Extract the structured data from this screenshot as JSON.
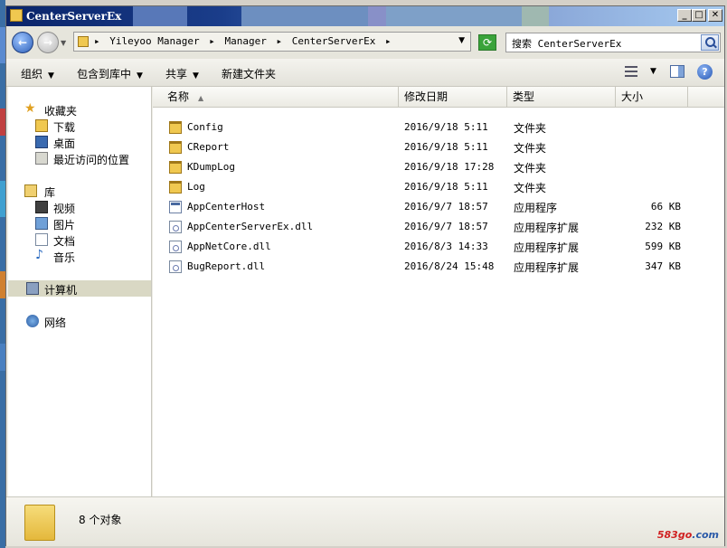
{
  "window": {
    "title": "CenterServerEx",
    "controls": {
      "minimize": "_",
      "maximize": "□",
      "close": "✕"
    }
  },
  "address_bar": {
    "crumbs": [
      "Yileyoo Manager",
      "Manager",
      "CenterServerEx"
    ],
    "separator": "▸",
    "search_placeholder": "搜索 CenterServerEx"
  },
  "toolbar": {
    "organize": "组织",
    "include_in_library": "包含到库中",
    "share": "共享",
    "new_folder": "新建文件夹"
  },
  "nav": {
    "favorites": "收藏夹",
    "downloads": "下载",
    "desktop": "桌面",
    "recent": "最近访问的位置",
    "libraries": "库",
    "videos": "视频",
    "pictures": "图片",
    "documents": "文档",
    "music": "音乐",
    "computer": "计算机",
    "network": "网络"
  },
  "columns": {
    "name": "名称",
    "date": "修改日期",
    "type": "类型",
    "size": "大小"
  },
  "files": [
    {
      "name": "Config",
      "date": "2016/9/18 5:11",
      "type": "文件夹",
      "size": "",
      "icon": "folder-icon"
    },
    {
      "name": "CReport",
      "date": "2016/9/18 5:11",
      "type": "文件夹",
      "size": "",
      "icon": "folder-icon"
    },
    {
      "name": "KDumpLog",
      "date": "2016/9/18 17:28",
      "type": "文件夹",
      "size": "",
      "icon": "folder-icon"
    },
    {
      "name": "Log",
      "date": "2016/9/18 5:11",
      "type": "文件夹",
      "size": "",
      "icon": "folder-icon"
    },
    {
      "name": "AppCenterHost",
      "date": "2016/9/7 18:57",
      "type": "应用程序",
      "size": "66 KB",
      "icon": "application-icon"
    },
    {
      "name": "AppCenterServerEx.dll",
      "date": "2016/9/7 18:57",
      "type": "应用程序扩展",
      "size": "232 KB",
      "icon": "dll-icon"
    },
    {
      "name": "AppNetCore.dll",
      "date": "2016/8/3 14:33",
      "type": "应用程序扩展",
      "size": "599 KB",
      "icon": "dll-icon"
    },
    {
      "name": "BugReport.dll",
      "date": "2016/8/24 15:48",
      "type": "应用程序扩展",
      "size": "347 KB",
      "icon": "dll-icon"
    }
  ],
  "details": {
    "count": "8 个对象"
  },
  "watermark": {
    "part1": "583go",
    "part2": ".com"
  }
}
